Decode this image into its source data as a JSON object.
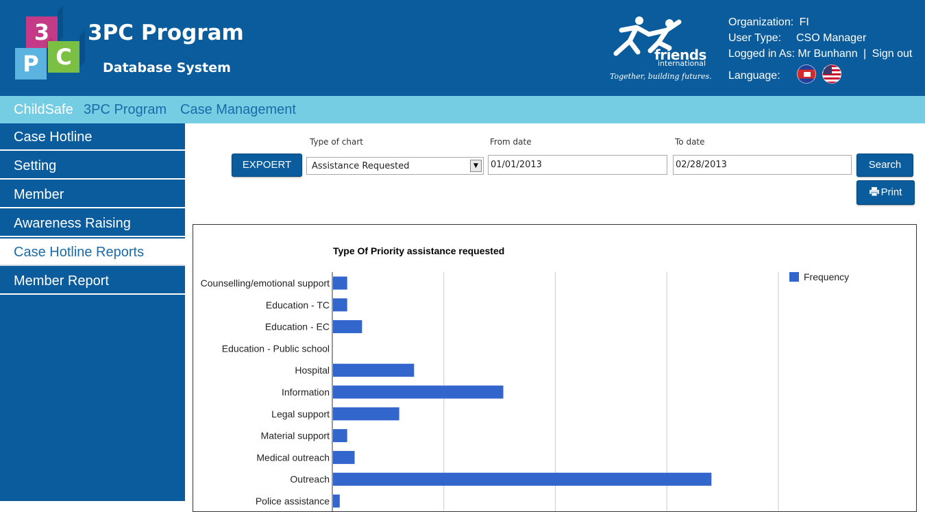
{
  "header": {
    "logo_letters": [
      "3",
      "P",
      "C"
    ],
    "title": "3PC Program",
    "subtitle": "Database System",
    "partner_logo": {
      "name": "friends",
      "sub": "international",
      "tagline": "Together, building futures."
    },
    "user_info": {
      "organization_label": "Organization:",
      "organization_value": "FI",
      "user_type_label": "User Type:",
      "user_type_value": "CSO Manager",
      "logged_in_label": "Logged in As:",
      "logged_in_value": "Mr Bunhann",
      "separator": "|",
      "sign_out": "Sign out",
      "language_label": "Language:"
    },
    "languages": [
      "cambodia-flag-icon",
      "usa-flag-icon"
    ]
  },
  "topnav": {
    "items": [
      {
        "label": "ChildSafe",
        "active": true
      },
      {
        "label": "3PC Program",
        "active": false
      },
      {
        "label": "Case Management",
        "active": false
      }
    ]
  },
  "sidebar": {
    "items": [
      {
        "label": "Case Hotline",
        "active": false
      },
      {
        "label": "Setting",
        "active": false
      },
      {
        "label": "Member",
        "active": false
      },
      {
        "label": "Awareness Raising",
        "active": false
      },
      {
        "label": "Case Hotline Reports",
        "active": true
      },
      {
        "label": "Member Report",
        "active": false
      }
    ]
  },
  "filters": {
    "type_of_chart_label": "Type of chart",
    "type_of_chart_value": "Assistance Requested",
    "from_date_label": "From date",
    "from_date_value": "01/01/2013",
    "to_date_label": "To date",
    "to_date_value": "02/28/2013",
    "export_label": "EXPOERT",
    "search_label": "Search",
    "print_label": "Print"
  },
  "colors": {
    "header_bg": "#0a5c9c",
    "nav_bg": "#74cde3",
    "bar": "#3366cc"
  },
  "chart_data": {
    "type": "bar",
    "orientation": "horizontal",
    "title": "Type Of Priority assistance requested",
    "categories": [
      "Counselling/emotional support",
      "Education - TC",
      "Education - EC",
      "Education - Public school",
      "Hospital",
      "Information",
      "Legal support",
      "Material support",
      "Medical outreach",
      "Outreach",
      "Police assistance"
    ],
    "series": [
      {
        "name": "Frequency",
        "values": [
          2,
          2,
          4,
          0,
          11,
          23,
          9,
          2,
          3,
          51,
          1
        ]
      }
    ],
    "xlim": [
      0,
      60
    ],
    "grid": true,
    "legend": "right"
  }
}
